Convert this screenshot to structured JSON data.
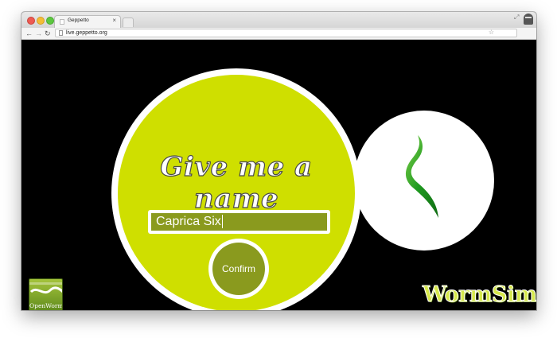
{
  "browser": {
    "tab_title": "Geppetto",
    "tab_close": "×",
    "url": "live.geppetto.org",
    "icons": {
      "back": "arrow-left-icon",
      "forward": "arrow-right-icon",
      "reload": "reload-icon",
      "star": "star-icon",
      "menu": "hamburger-menu-icon",
      "fullscreen": "fullscreen-icon",
      "profile": "incognito-profile-icon"
    }
  },
  "page": {
    "headline": "Give me a name",
    "name_input": {
      "value": "Caprica Six"
    },
    "confirm_label": "Confirm",
    "openworm_label": "OpenWorm",
    "wormsim_label": "WormSim",
    "colors": {
      "background": "#000000",
      "accent_green": "#cfdf00",
      "dark_olive": "#8a9a1e",
      "worm_green": "#1f9a20"
    }
  }
}
